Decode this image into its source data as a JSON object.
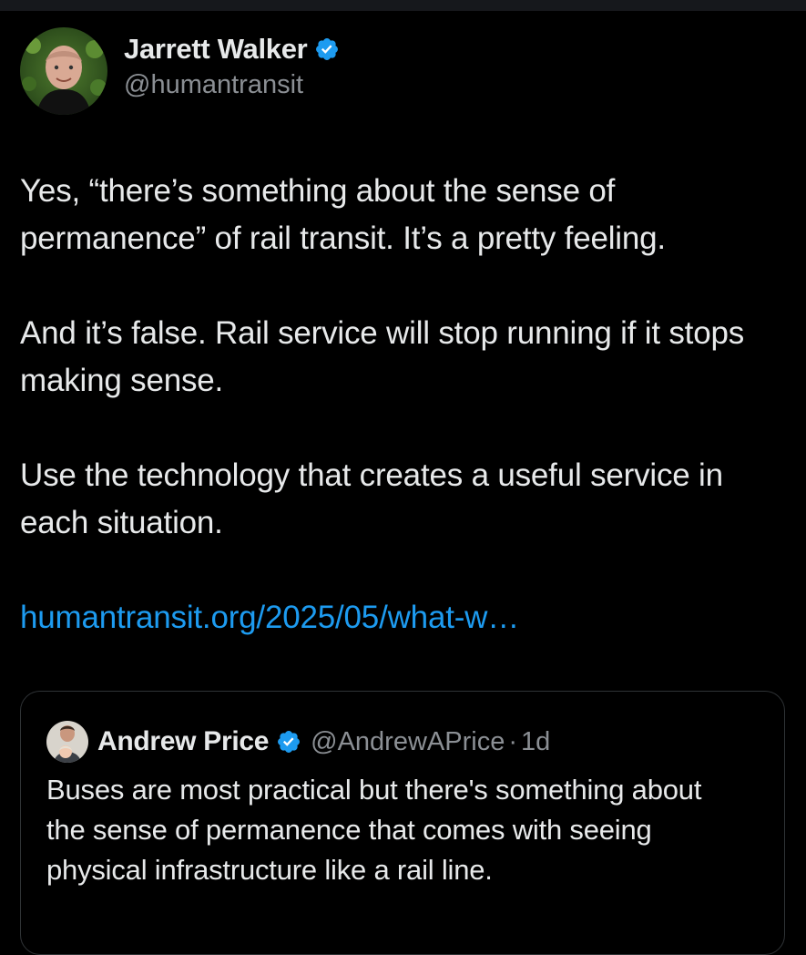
{
  "tweet": {
    "author": {
      "display_name": "Jarrett Walker",
      "handle": "@humantransit",
      "verified": true,
      "avatar_icon": "avatar-jarrett"
    },
    "paragraphs": [
      "Yes, “there’s something about the sense of permanence” of rail transit.  It’s a pretty feeling.",
      "And it’s false.  Rail service will stop running if it stops making sense.",
      "Use the technology that creates a useful service in each situation."
    ],
    "link_text": "humantransit.org/2025/05/what-w…"
  },
  "quote": {
    "author": {
      "display_name": "Andrew Price",
      "handle": "@AndrewAPrice",
      "separator": "·",
      "time": "1d",
      "verified": true,
      "avatar_icon": "avatar-andrew"
    },
    "text": "Buses are most practical but there's something about the sense of permanence that comes with seeing physical infrastructure like a rail line."
  },
  "colors": {
    "background": "#000000",
    "text": "#e7e9ea",
    "secondary": "#8b8f94",
    "link": "#1d9bf0",
    "verified_badge": "#1d9bf0",
    "border": "#2f3336"
  }
}
